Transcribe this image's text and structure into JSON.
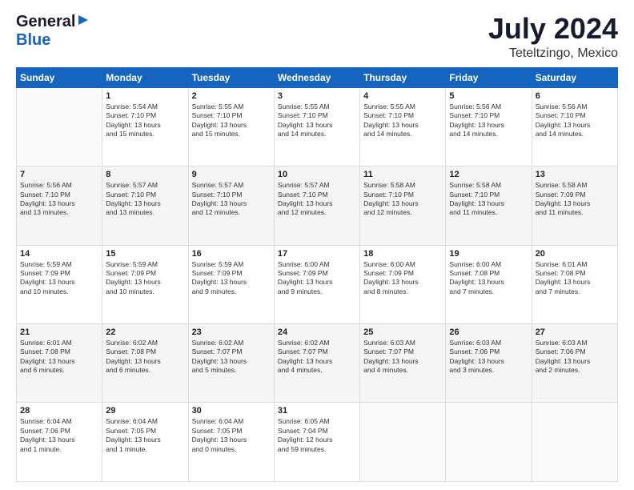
{
  "header": {
    "logo_general": "General",
    "logo_blue": "Blue",
    "month_title": "July 2024",
    "location": "Teteltzingo, Mexico"
  },
  "weekdays": [
    "Sunday",
    "Monday",
    "Tuesday",
    "Wednesday",
    "Thursday",
    "Friday",
    "Saturday"
  ],
  "weeks": [
    [
      {
        "day": "",
        "info": ""
      },
      {
        "day": "1",
        "info": "Sunrise: 5:54 AM\nSunset: 7:10 PM\nDaylight: 13 hours\nand 15 minutes."
      },
      {
        "day": "2",
        "info": "Sunrise: 5:55 AM\nSunset: 7:10 PM\nDaylight: 13 hours\nand 15 minutes."
      },
      {
        "day": "3",
        "info": "Sunrise: 5:55 AM\nSunset: 7:10 PM\nDaylight: 13 hours\nand 14 minutes."
      },
      {
        "day": "4",
        "info": "Sunrise: 5:55 AM\nSunset: 7:10 PM\nDaylight: 13 hours\nand 14 minutes."
      },
      {
        "day": "5",
        "info": "Sunrise: 5:56 AM\nSunset: 7:10 PM\nDaylight: 13 hours\nand 14 minutes."
      },
      {
        "day": "6",
        "info": "Sunrise: 5:56 AM\nSunset: 7:10 PM\nDaylight: 13 hours\nand 14 minutes."
      }
    ],
    [
      {
        "day": "7",
        "info": "Sunrise: 5:56 AM\nSunset: 7:10 PM\nDaylight: 13 hours\nand 13 minutes."
      },
      {
        "day": "8",
        "info": "Sunrise: 5:57 AM\nSunset: 7:10 PM\nDaylight: 13 hours\nand 13 minutes."
      },
      {
        "day": "9",
        "info": "Sunrise: 5:57 AM\nSunset: 7:10 PM\nDaylight: 13 hours\nand 12 minutes."
      },
      {
        "day": "10",
        "info": "Sunrise: 5:57 AM\nSunset: 7:10 PM\nDaylight: 13 hours\nand 12 minutes."
      },
      {
        "day": "11",
        "info": "Sunrise: 5:58 AM\nSunset: 7:10 PM\nDaylight: 13 hours\nand 12 minutes."
      },
      {
        "day": "12",
        "info": "Sunrise: 5:58 AM\nSunset: 7:10 PM\nDaylight: 13 hours\nand 11 minutes."
      },
      {
        "day": "13",
        "info": "Sunrise: 5:58 AM\nSunset: 7:09 PM\nDaylight: 13 hours\nand 11 minutes."
      }
    ],
    [
      {
        "day": "14",
        "info": "Sunrise: 5:59 AM\nSunset: 7:09 PM\nDaylight: 13 hours\nand 10 minutes."
      },
      {
        "day": "15",
        "info": "Sunrise: 5:59 AM\nSunset: 7:09 PM\nDaylight: 13 hours\nand 10 minutes."
      },
      {
        "day": "16",
        "info": "Sunrise: 5:59 AM\nSunset: 7:09 PM\nDaylight: 13 hours\nand 9 minutes."
      },
      {
        "day": "17",
        "info": "Sunrise: 6:00 AM\nSunset: 7:09 PM\nDaylight: 13 hours\nand 9 minutes."
      },
      {
        "day": "18",
        "info": "Sunrise: 6:00 AM\nSunset: 7:09 PM\nDaylight: 13 hours\nand 8 minutes."
      },
      {
        "day": "19",
        "info": "Sunrise: 6:00 AM\nSunset: 7:08 PM\nDaylight: 13 hours\nand 7 minutes."
      },
      {
        "day": "20",
        "info": "Sunrise: 6:01 AM\nSunset: 7:08 PM\nDaylight: 13 hours\nand 7 minutes."
      }
    ],
    [
      {
        "day": "21",
        "info": "Sunrise: 6:01 AM\nSunset: 7:08 PM\nDaylight: 13 hours\nand 6 minutes."
      },
      {
        "day": "22",
        "info": "Sunrise: 6:02 AM\nSunset: 7:08 PM\nDaylight: 13 hours\nand 6 minutes."
      },
      {
        "day": "23",
        "info": "Sunrise: 6:02 AM\nSunset: 7:07 PM\nDaylight: 13 hours\nand 5 minutes."
      },
      {
        "day": "24",
        "info": "Sunrise: 6:02 AM\nSunset: 7:07 PM\nDaylight: 13 hours\nand 4 minutes."
      },
      {
        "day": "25",
        "info": "Sunrise: 6:03 AM\nSunset: 7:07 PM\nDaylight: 13 hours\nand 4 minutes."
      },
      {
        "day": "26",
        "info": "Sunrise: 6:03 AM\nSunset: 7:06 PM\nDaylight: 13 hours\nand 3 minutes."
      },
      {
        "day": "27",
        "info": "Sunrise: 6:03 AM\nSunset: 7:06 PM\nDaylight: 13 hours\nand 2 minutes."
      }
    ],
    [
      {
        "day": "28",
        "info": "Sunrise: 6:04 AM\nSunset: 7:06 PM\nDaylight: 13 hours\nand 1 minute."
      },
      {
        "day": "29",
        "info": "Sunrise: 6:04 AM\nSunset: 7:05 PM\nDaylight: 13 hours\nand 1 minute."
      },
      {
        "day": "30",
        "info": "Sunrise: 6:04 AM\nSunset: 7:05 PM\nDaylight: 13 hours\nand 0 minutes."
      },
      {
        "day": "31",
        "info": "Sunrise: 6:05 AM\nSunset: 7:04 PM\nDaylight: 12 hours\nand 59 minutes."
      },
      {
        "day": "",
        "info": ""
      },
      {
        "day": "",
        "info": ""
      },
      {
        "day": "",
        "info": ""
      }
    ]
  ]
}
